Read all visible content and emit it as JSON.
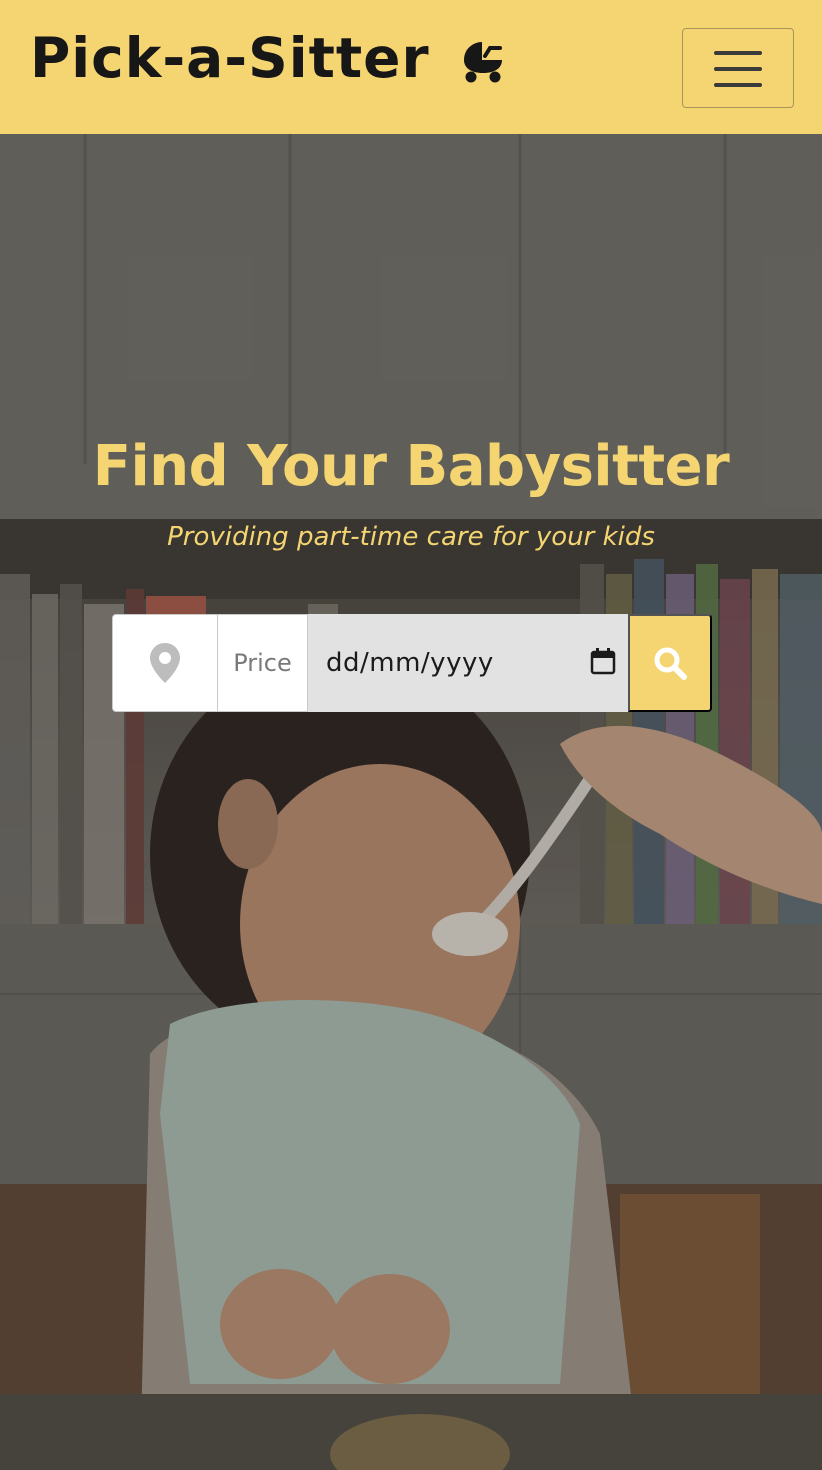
{
  "navbar": {
    "brand": "Pick-a-Sitter",
    "brand_icon": "baby-carriage-icon",
    "menu_icon": "hamburger-menu-icon"
  },
  "hero": {
    "title": "Find Your Babysitter",
    "subtitle": "Providing part-time care for your kids"
  },
  "search": {
    "location_icon": "map-marker-icon",
    "price_placeholder": "Price",
    "date_placeholder": "dd/mm/yyyy",
    "calendar_icon": "calendar-icon",
    "search_icon": "search-icon"
  },
  "colors": {
    "accent": "#f4d571",
    "dark_text": "#171717",
    "date_field_bg": "#e2e2e2"
  }
}
